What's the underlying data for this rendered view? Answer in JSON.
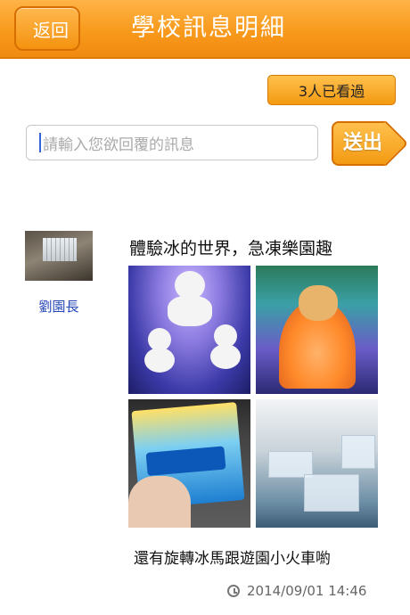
{
  "header": {
    "back_label": "返回",
    "title": "學校訊息明細"
  },
  "views": {
    "label": "3人已看過"
  },
  "reply": {
    "placeholder": "請輸入您欲回覆的訊息",
    "send_label": "送出"
  },
  "post": {
    "author": "劉園長",
    "title": "體驗冰的世界，急凍樂園趣",
    "caption": "還有旋轉冰馬跟遊園小火車喲",
    "timestamp": "2014/09/01  14:46",
    "photos": [
      "snowmen-photo",
      "orange-figure-photo",
      "ticket-photo",
      "ice-benches-photo"
    ]
  },
  "colors": {
    "header_orange": "#f89a1c",
    "author_blue": "#2446b8"
  }
}
